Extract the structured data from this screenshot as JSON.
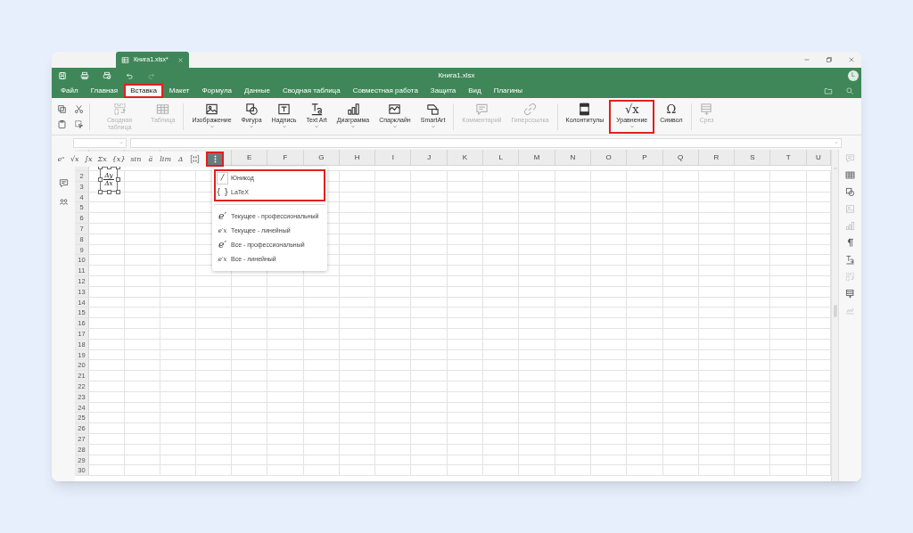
{
  "tab": {
    "title": "Книга1.xlsx*",
    "selected": true
  },
  "window": {
    "title": "Книга1.xlsx",
    "avatar": "L"
  },
  "quick_access": [
    {
      "disabled": false
    },
    {
      "disabled": false
    },
    {
      "disabled": false
    },
    {
      "disabled": false
    },
    {
      "disabled": true
    }
  ],
  "menu": [
    {
      "label": "Файл",
      "selected": false,
      "highlighted": false
    },
    {
      "label": "Главная",
      "selected": false,
      "highlighted": false
    },
    {
      "label": "Вставка",
      "selected": true,
      "highlighted": true
    },
    {
      "label": "Макет",
      "selected": false,
      "highlighted": false
    },
    {
      "label": "Формула",
      "selected": false,
      "highlighted": false
    },
    {
      "label": "Данные",
      "selected": false,
      "highlighted": false
    },
    {
      "label": "Сводная таблица",
      "selected": false,
      "highlighted": false
    },
    {
      "label": "Совместная работа",
      "selected": false,
      "highlighted": false
    },
    {
      "label": "Защита",
      "selected": false,
      "highlighted": false
    },
    {
      "label": "Вид",
      "selected": false,
      "highlighted": false
    },
    {
      "label": "Плагины",
      "selected": false,
      "highlighted": false
    }
  ],
  "ribbon": [
    {
      "kind": "small",
      "items": [
        {
          "disabled": false
        },
        {
          "disabled": false
        },
        {
          "disabled": false
        },
        {
          "disabled": false
        }
      ]
    },
    {
      "kind": "large",
      "items": [
        {
          "label": "Сводная таблица",
          "disabled": true,
          "dropdown": false,
          "highlighted": false
        },
        {
          "label": "Таблица",
          "disabled": true,
          "dropdown": false,
          "highlighted": false
        }
      ]
    },
    {
      "kind": "large",
      "items": [
        {
          "label": "Изображение",
          "disabled": false,
          "dropdown": true,
          "highlighted": false
        },
        {
          "label": "Фигура",
          "disabled": false,
          "dropdown": true,
          "highlighted": false
        },
        {
          "label": "Надпись",
          "disabled": false,
          "dropdown": true,
          "highlighted": false
        },
        {
          "label": "Text Art",
          "disabled": false,
          "dropdown": true,
          "highlighted": false
        },
        {
          "label": "Диаграмма",
          "disabled": false,
          "dropdown": true,
          "highlighted": false
        },
        {
          "label": "Спарклайн",
          "disabled": false,
          "dropdown": true,
          "highlighted": false
        },
        {
          "label": "SmartArt",
          "disabled": false,
          "dropdown": true,
          "highlighted": false
        }
      ]
    },
    {
      "kind": "large",
      "items": [
        {
          "label": "Комментарий",
          "disabled": true,
          "dropdown": false,
          "highlighted": false
        },
        {
          "label": "Гиперссылка",
          "disabled": true,
          "dropdown": false,
          "highlighted": false
        }
      ]
    },
    {
      "kind": "large",
      "items": [
        {
          "label": "Колонтитулы",
          "disabled": false,
          "dropdown": false,
          "highlighted": false
        },
        {
          "glyph": "√x",
          "label": "Уравнение",
          "disabled": false,
          "dropdown": true,
          "highlighted": true
        },
        {
          "glyph": "Ω",
          "label": "Символ",
          "disabled": false,
          "dropdown": false,
          "highlighted": false
        }
      ]
    },
    {
      "kind": "large",
      "items": [
        {
          "label": "Срез",
          "disabled": true,
          "dropdown": false,
          "highlighted": false
        }
      ]
    }
  ],
  "equation_toolbar": [
    {
      "kind": "glyph",
      "glyph": "eˣ"
    },
    {
      "kind": "glyph",
      "glyph": "√x"
    },
    {
      "kind": "glyph",
      "glyph": "∫x"
    },
    {
      "kind": "glyph",
      "glyph": "Σx"
    },
    {
      "kind": "glyph",
      "glyph": "{x}"
    },
    {
      "kind": "glyph",
      "glyph": "sin"
    },
    {
      "kind": "glyph",
      "glyph": "ä"
    },
    {
      "kind": "glyph",
      "glyph": "lim"
    },
    {
      "kind": "glyph",
      "glyph": "Δ"
    },
    {
      "kind": "matrix"
    },
    {
      "kind": "more",
      "selected": true,
      "highlighted": true
    }
  ],
  "equation_menu": [
    {
      "highlighted": true,
      "items": [
        {
          "kind": "boxed",
          "glyph": "/",
          "label": "Юникод"
        },
        {
          "kind": "plain",
          "glyph": "{ }",
          "label": "LaTeX"
        }
      ]
    },
    {
      "highlighted": false,
      "items": [
        {
          "kind": "large",
          "glyph": "e′",
          "label": "Текущее - профессиональный"
        },
        {
          "kind": "small",
          "glyph": "e′x",
          "label": "Текущее - линейный"
        },
        {
          "kind": "large",
          "glyph": "e′",
          "label": "Все - профессиональный"
        },
        {
          "kind": "small",
          "glyph": "e′x",
          "label": "Все - линейный"
        }
      ]
    }
  ],
  "equation": {
    "numerator": "Δy",
    "denominator": "Δx"
  },
  "columns": [
    "E",
    "F",
    "G",
    "H",
    "I",
    "J",
    "K",
    "L",
    "M",
    "N",
    "O",
    "P",
    "Q",
    "R",
    "S",
    "T",
    "U"
  ],
  "rows": [
    "2",
    "3",
    "4",
    "5",
    "6",
    "7",
    "8",
    "9",
    "10",
    "11",
    "12",
    "13",
    "14",
    "15",
    "16",
    "17",
    "18",
    "19",
    "20",
    "21",
    "22",
    "23",
    "24",
    "25",
    "26",
    "27",
    "28",
    "29",
    "30"
  ],
  "left_sidebar": [
    {
      "disabled": false
    },
    {
      "disabled": false
    }
  ],
  "right_sidebar": [
    {
      "disabled": true
    },
    {
      "disabled": false
    },
    {
      "disabled": false
    },
    {
      "disabled": true
    },
    {
      "disabled": true
    },
    {
      "disabled": false
    },
    {
      "disabled": false
    },
    {
      "disabled": true
    },
    {
      "disabled": false
    },
    {
      "disabled": true
    }
  ]
}
